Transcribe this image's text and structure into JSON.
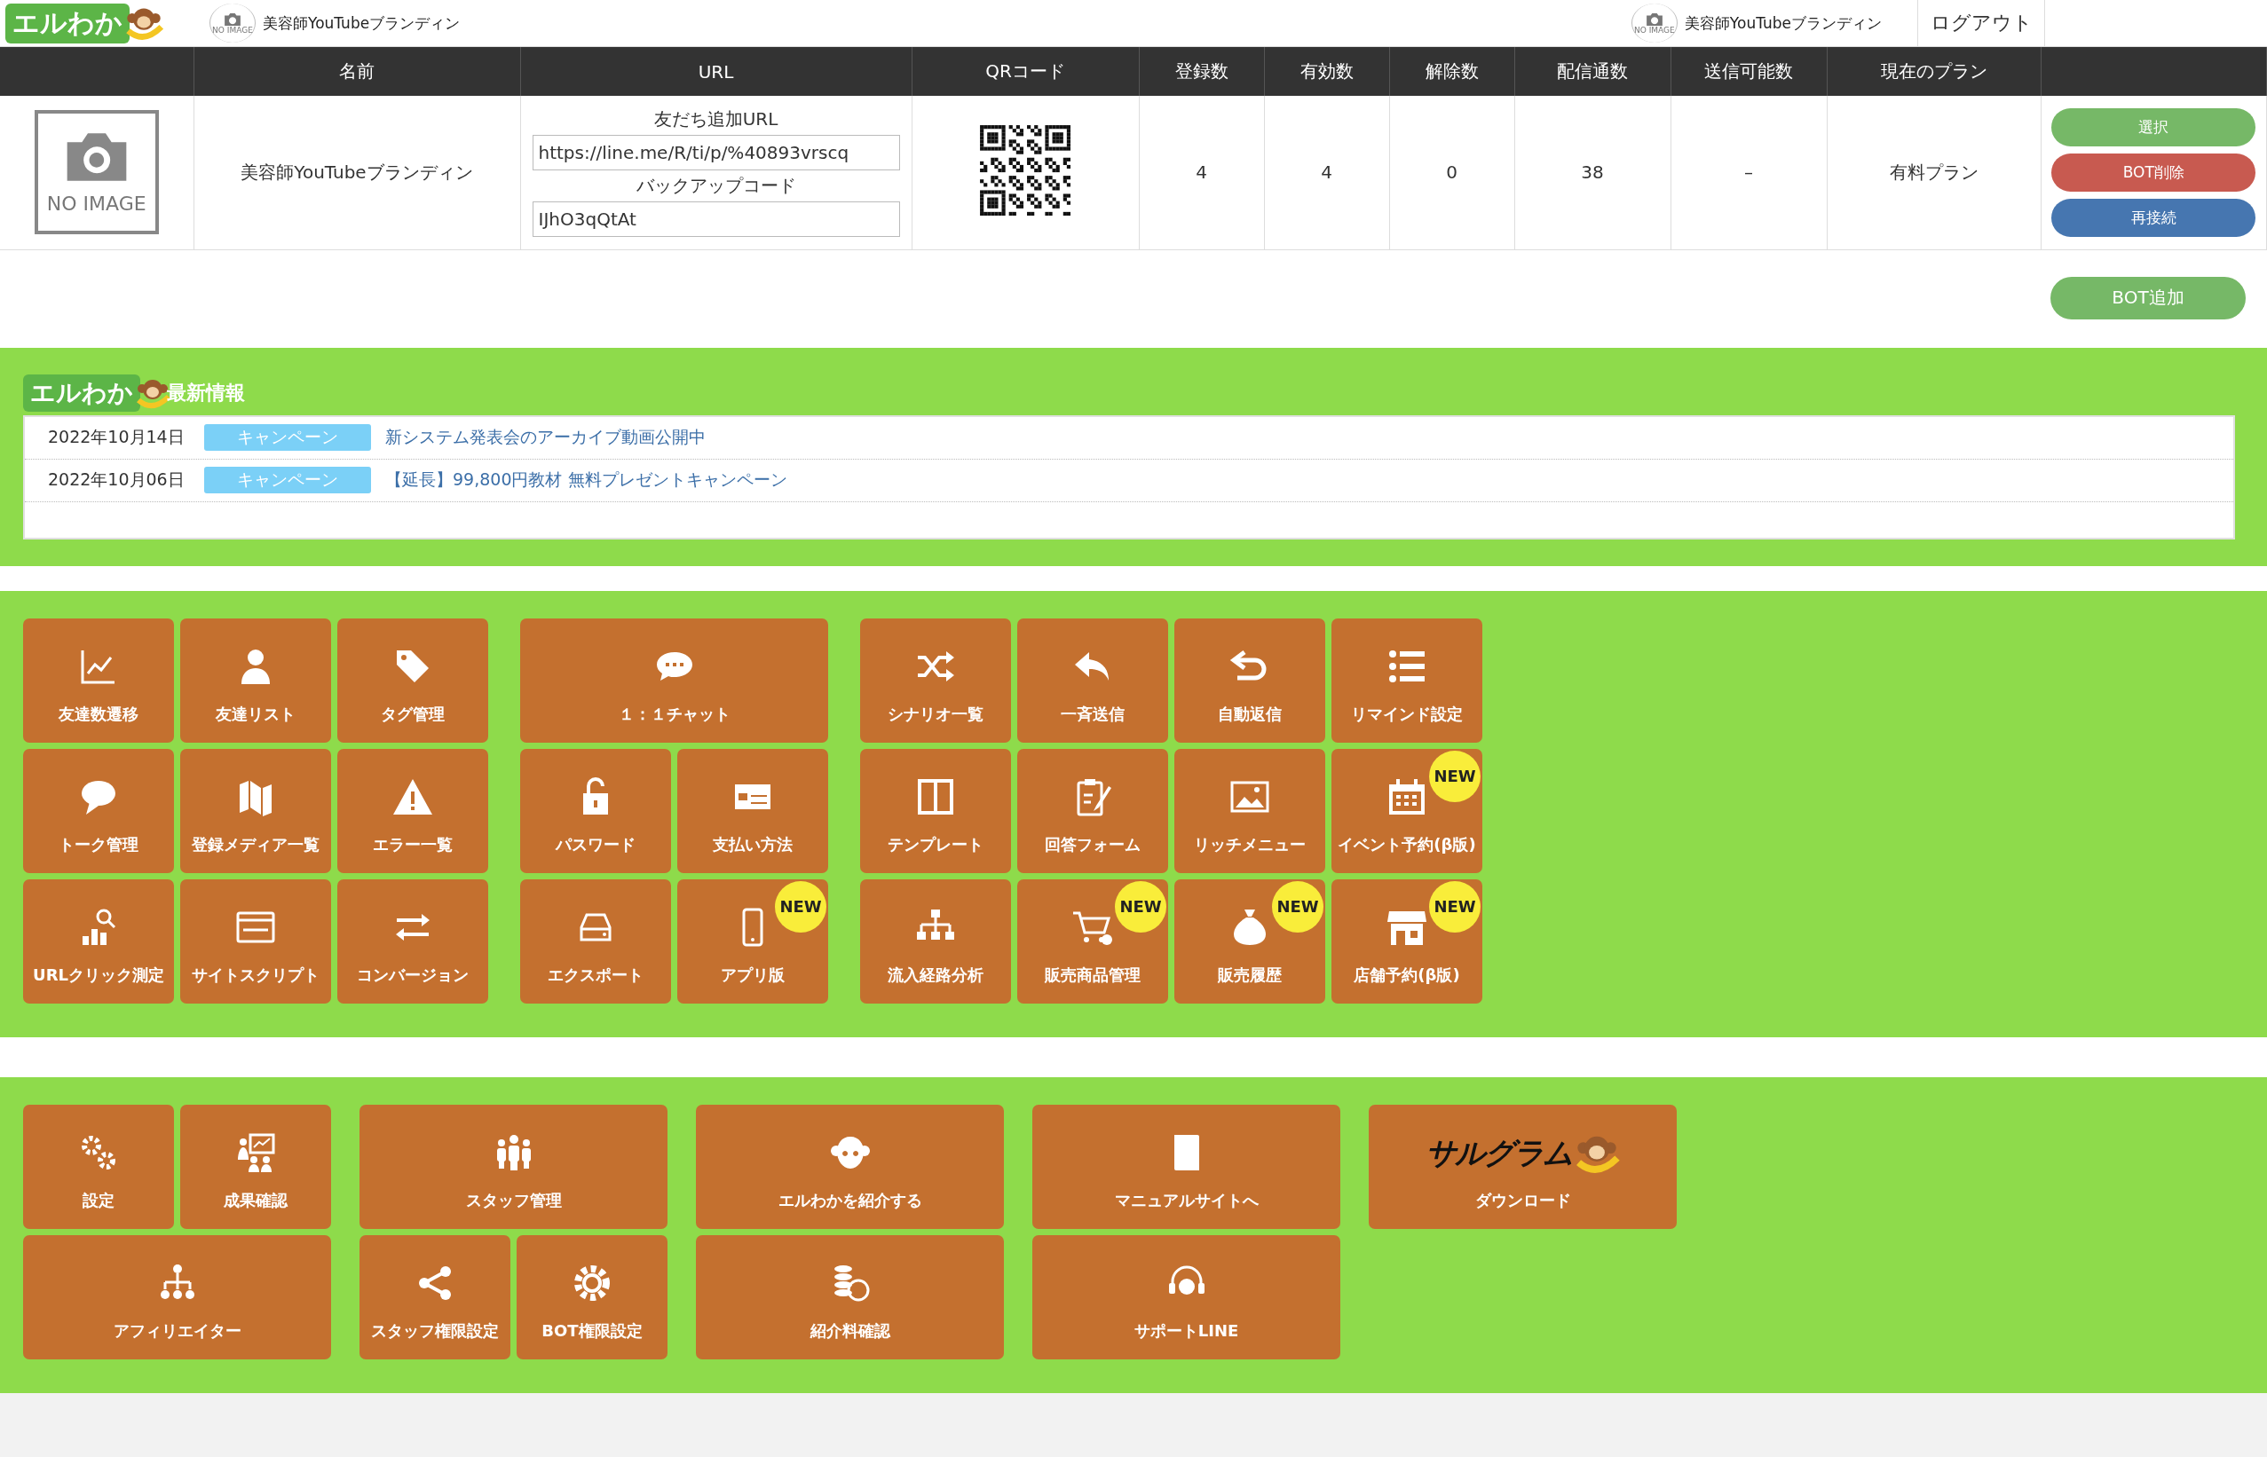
{
  "header": {
    "logo": "エルわか",
    "account": {
      "avatar_caption": "NO IMAGE",
      "name": "美容師YouTubeブランディン"
    },
    "account_right": {
      "avatar_caption": "NO IMAGE",
      "name": "美容師YouTubeブランディン"
    },
    "logout": "ログアウト"
  },
  "table": {
    "columns": [
      "名前",
      "URL",
      "QRコード",
      "登録数",
      "有効数",
      "解除数",
      "配信通数",
      "送信可能数",
      "現在のプラン"
    ],
    "rows": [
      {
        "image_caption": "NO IMAGE",
        "name": "美容師YouTubeブランディン",
        "url_label": "友だち追加URL",
        "url": "https://line.me/R/ti/p/%40893vrscq",
        "backup_label": "バックアップコード",
        "backup_code": "IJhO3qQtAt",
        "registered": "4",
        "active": "4",
        "unsubscribed": "0",
        "deliveries": "38",
        "sendable": "–",
        "plan": "有料プラン",
        "actions": [
          {
            "label": "選択",
            "kind": "select"
          },
          {
            "label": "BOT削除",
            "kind": "delete"
          },
          {
            "label": "再接続",
            "kind": "reconnect"
          }
        ]
      }
    ]
  },
  "add_bot": "BOT追加",
  "news": {
    "brand": "エルわか",
    "title": "最新情報",
    "items": [
      {
        "date": "2022年10月14日",
        "tag": "キャンペーン",
        "text": "新システム発表会のアーカイブ動画公開中"
      },
      {
        "date": "2022年10月06日",
        "tag": "キャンペーン",
        "text": "【延長】99,800円教材 無料プレゼントキャンペーン"
      }
    ]
  },
  "menu_sections": [
    {
      "groups": [
        {
          "tiles": [
            {
              "label": "友達数遷移",
              "kind": "small"
            },
            {
              "label": "友達リスト",
              "kind": "small"
            },
            {
              "label": "タグ管理",
              "kind": "small"
            },
            {
              "label": "トーク管理",
              "kind": "small"
            },
            {
              "label": "登録メディア一覧",
              "kind": "small"
            },
            {
              "label": "エラー一覧",
              "kind": "small"
            },
            {
              "label": "URLクリック測定",
              "kind": "small"
            },
            {
              "label": "サイトスクリプト",
              "kind": "small"
            },
            {
              "label": "コンバージョン",
              "kind": "small"
            }
          ]
        },
        {
          "tiles": [
            {
              "label": "１：１チャット",
              "kind": "wide"
            },
            {
              "label": "パスワード",
              "kind": "small"
            },
            {
              "label": "支払い方法",
              "kind": "small"
            },
            {
              "label": "エクスポート",
              "kind": "small"
            },
            {
              "label": "アプリ版",
              "kind": "small",
              "badge": "NEW"
            }
          ]
        },
        {
          "tiles": [
            {
              "label": "シナリオ一覧",
              "kind": "small"
            },
            {
              "label": "一斉送信",
              "kind": "small"
            },
            {
              "label": "自動返信",
              "kind": "small"
            },
            {
              "label": "リマインド設定",
              "kind": "small"
            },
            {
              "label": "テンプレート",
              "kind": "small"
            },
            {
              "label": "回答フォーム",
              "kind": "small"
            },
            {
              "label": "リッチメニュー",
              "kind": "small"
            },
            {
              "label": "イベント予約(β版)",
              "kind": "small",
              "badge": "NEW"
            },
            {
              "label": "流入経路分析",
              "kind": "small"
            },
            {
              "label": "販売商品管理",
              "kind": "small",
              "badge": "NEW"
            },
            {
              "label": "販売履歴",
              "kind": "small",
              "badge": "NEW"
            },
            {
              "label": "店舗予約(β版)",
              "kind": "small",
              "badge": "NEW"
            }
          ]
        }
      ]
    },
    {
      "groups": [
        {
          "tiles": [
            {
              "label": "設定",
              "kind": "small"
            },
            {
              "label": "成果確認",
              "kind": "small"
            },
            {
              "label": "アフィリエイター",
              "kind": "wide"
            }
          ]
        },
        {
          "tiles": [
            {
              "label": "スタッフ管理",
              "kind": "wide"
            },
            {
              "label": "スタッフ権限設定",
              "kind": "small"
            },
            {
              "label": "BOT権限設定",
              "kind": "small"
            }
          ]
        },
        {
          "tiles": [
            {
              "label": "エルわかを紹介する",
              "kind": "wide"
            },
            {
              "label": "紹介料確認",
              "kind": "wide"
            }
          ]
        },
        {
          "tiles": [
            {
              "label": "マニュアルサイトへ",
              "kind": "wide"
            },
            {
              "label": "サポートLINE",
              "kind": "wide"
            }
          ]
        },
        {
          "tiles": [
            {
              "label": "ダウンロード",
              "kind": "wide",
              "logo": "サルグラム"
            }
          ]
        }
      ]
    }
  ]
}
